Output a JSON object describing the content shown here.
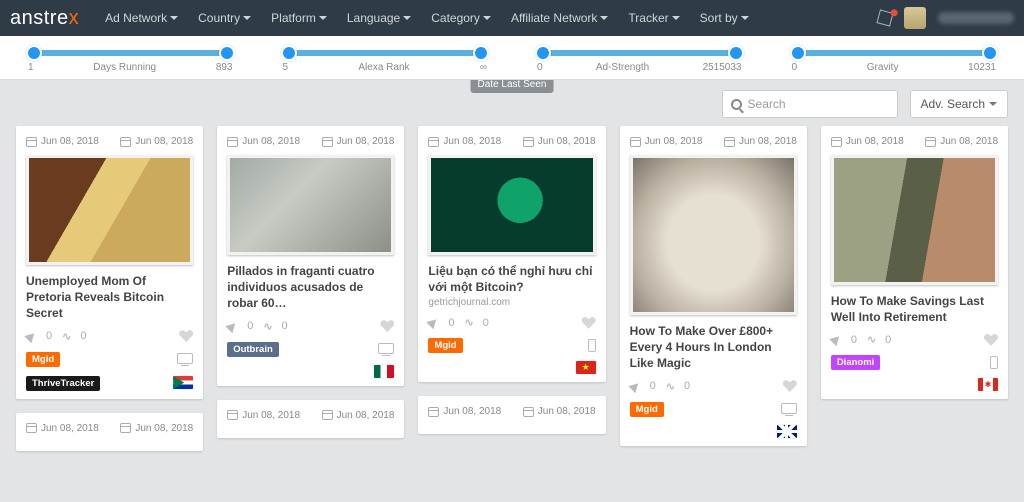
{
  "brand": {
    "name_pre": "anstre",
    "name_x": "x"
  },
  "nav": [
    "Ad Network",
    "Country",
    "Platform",
    "Language",
    "Category",
    "Affiliate Network",
    "Tracker",
    "Sort by"
  ],
  "sliders": [
    {
      "min": "1",
      "label": "Days Running",
      "max": "893"
    },
    {
      "min": "5",
      "label": "Alexa Rank",
      "max": "∞"
    },
    {
      "min": "0",
      "label": "Ad-Strength",
      "max": "2515033"
    },
    {
      "min": "0",
      "label": "Gravity",
      "max": "10231"
    }
  ],
  "search": {
    "placeholder": "Search",
    "adv": "Adv. Search"
  },
  "tooltip": "Date Last Seen",
  "date": "Jun 08, 2018",
  "cards": [
    {
      "title": "Unemployed Mom Of Pretoria Reveals Bitcoin Secret",
      "sub": "",
      "stat1": "0",
      "stat2": "0",
      "tags": [
        "Mgid"
      ],
      "tags2": [
        "ThriveTracker"
      ],
      "flag": "za",
      "device": "desktop",
      "thumb": "t1"
    },
    {
      "title": "Pillados in fraganti cuatro individuos acusados de robar 60…",
      "sub": "",
      "stat1": "0",
      "stat2": "0",
      "tags": [
        "Outbrain"
      ],
      "tags2": [],
      "flag": "mx",
      "device": "desktop",
      "thumb": "t2"
    },
    {
      "title": "Liệu bạn có thể nghỉ hưu chỉ với một Bitcoin?",
      "sub": "getrichjournal.com",
      "stat1": "0",
      "stat2": "0",
      "tags": [
        "Mgid"
      ],
      "tags2": [],
      "flag": "vn",
      "device": "phone",
      "thumb": "t3"
    },
    {
      "title": "How To Make Over £800+ Every 4 Hours In London Like Magic",
      "sub": "",
      "stat1": "0",
      "stat2": "0",
      "tags": [
        "Mgid"
      ],
      "tags2": [],
      "flag": "gb",
      "device": "desktop",
      "thumb": "t4"
    },
    {
      "title": "How To Make Savings Last Well Into Retirement",
      "sub": "",
      "stat1": "0",
      "stat2": "0",
      "tags": [
        "Dianomi"
      ],
      "tags2": [],
      "flag": "ca",
      "device": "phone",
      "thumb": "t5"
    }
  ]
}
